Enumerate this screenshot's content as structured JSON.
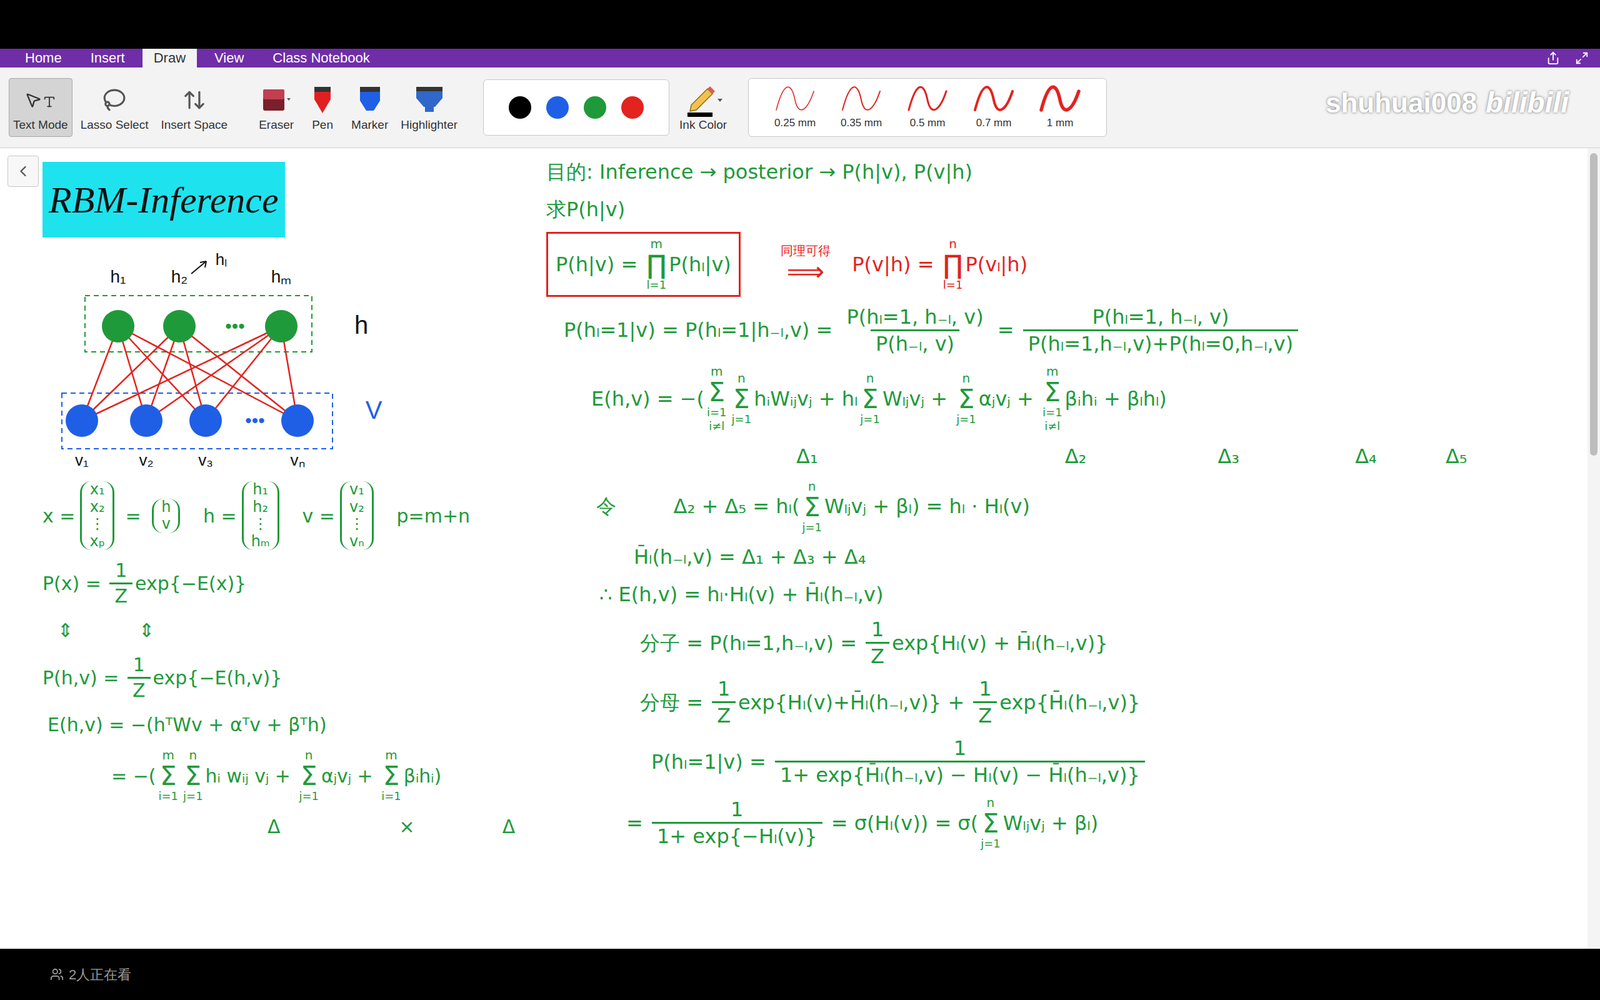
{
  "window": {
    "tabs": [
      {
        "label": "Home",
        "selected": false
      },
      {
        "label": "Insert",
        "selected": false
      },
      {
        "label": "Draw",
        "selected": true
      },
      {
        "label": "View",
        "selected": false
      },
      {
        "label": "Class Notebook",
        "selected": false
      }
    ]
  },
  "ribbon": {
    "tools": [
      {
        "label": "Text Mode",
        "selected": true,
        "kind": "text-mode"
      },
      {
        "label": "Lasso Select",
        "selected": false,
        "kind": "lasso"
      },
      {
        "label": "Insert Space",
        "selected": false,
        "kind": "space"
      },
      {
        "label": "Eraser",
        "selected": false,
        "kind": "eraser"
      },
      {
        "label": "Pen",
        "selected": false,
        "kind": "pen"
      },
      {
        "label": "Marker",
        "selected": false,
        "kind": "marker"
      },
      {
        "label": "Highlighter",
        "selected": false,
        "kind": "highlighter"
      }
    ],
    "swatches": [
      {
        "color": "#000000"
      },
      {
        "color": "#1f5fe6"
      },
      {
        "color": "#1f9a3a"
      },
      {
        "color": "#e3231f"
      }
    ],
    "ink_color": {
      "label": "Ink Color"
    },
    "thickness": [
      {
        "label": "0.25 mm"
      },
      {
        "label": "0.35 mm"
      },
      {
        "label": "0.5 mm"
      },
      {
        "label": "0.7 mm"
      },
      {
        "label": "1 mm"
      }
    ]
  },
  "watermark": {
    "user": "shuhuai008",
    "brand": "bilibili"
  },
  "page": {
    "title": "RBM-Inference",
    "diagram": {
      "hidden": [
        "h₁",
        "h₂",
        "hₘ"
      ],
      "visible": [
        "v₁",
        "v₂",
        "v₃",
        "vₙ"
      ],
      "ellipsis": "•••",
      "pointer_label": "hₗ",
      "hidden_layer": "h",
      "visible_layer": "V"
    },
    "left_notes": [
      {
        "groups": [
          {
            "color": "#1f9a3a",
            "boxed": false,
            "parts": [
              {
                "kind": "text",
                "text": "x ="
              },
              {
                "kind": "vec",
                "items": [
                  "x₁",
                  "x₂",
                  "⋮",
                  "xₚ"
                ]
              },
              {
                "kind": "text",
                "text": " = "
              },
              {
                "kind": "vec",
                "items": [
                  "h",
                  "v"
                ]
              },
              {
                "kind": "text",
                "text": "   h ="
              },
              {
                "kind": "vec",
                "items": [
                  "h₁",
                  "h₂",
                  "⋮",
                  "hₘ"
                ]
              },
              {
                "kind": "text",
                "text": "   v ="
              },
              {
                "kind": "vec",
                "items": [
                  "v₁",
                  "v₂",
                  "⋮",
                  "vₙ"
                ]
              },
              {
                "kind": "text",
                "text": "   p=m+n"
              }
            ]
          }
        ]
      },
      {
        "groups": [
          {
            "color": "#1f9a3a",
            "boxed": false,
            "parts": [
              {
                "kind": "text",
                "text": "P(x) = "
              },
              {
                "kind": "frac",
                "num": "1",
                "den": "Z"
              },
              {
                "kind": "text",
                "text": "exp{−E(x)}"
              }
            ]
          }
        ]
      },
      {
        "groups": [
          {
            "color": "#1f9a3a",
            "boxed": false,
            "parts": [
              {
                "kind": "text",
                "text": "⇕           ⇕"
              }
            ]
          }
        ]
      },
      {
        "groups": [
          {
            "color": "#1f9a3a",
            "boxed": false,
            "parts": [
              {
                "kind": "text",
                "text": "P(h,v) = "
              },
              {
                "kind": "frac",
                "num": "1",
                "den": "Z"
              },
              {
                "kind": "text",
                "text": "exp{−E(h,v)}"
              }
            ]
          }
        ]
      },
      {
        "groups": [
          {
            "color": "#1f9a3a",
            "boxed": false,
            "parts": [
              {
                "kind": "text",
                "text": "E(h,v) = −(hᵀWv + αᵀv + βᵀh)"
              }
            ]
          }
        ]
      },
      {
        "groups": [
          {
            "color": "#1f9a3a",
            "boxed": false,
            "parts": [
              {
                "kind": "text",
                "text": "= −("
              },
              {
                "kind": "sum",
                "sym": "Σ",
                "top": "m",
                "bottom": [
                  "i=1"
                ]
              },
              {
                "kind": "sum",
                "sym": "Σ",
                "top": "n",
                "bottom": [
                  "j=1"
                ]
              },
              {
                "kind": "text",
                "text": "hᵢ wᵢⱼ vⱼ + "
              },
              {
                "kind": "sum",
                "sym": "Σ",
                "top": "n",
                "bottom": [
                  "j=1"
                ]
              },
              {
                "kind": "text",
                "text": "αⱼvⱼ + "
              },
              {
                "kind": "sum",
                "sym": "Σ",
                "top": "m",
                "bottom": [
                  "i=1"
                ]
              },
              {
                "kind": "text",
                "text": "βᵢhᵢ)"
              }
            ]
          }
        ]
      },
      {
        "groups": [
          {
            "color": "#1f9a3a",
            "boxed": false,
            "parts": [
              {
                "kind": "labels",
                "items": [
                  "Δ",
                  "×",
                  "Δ"
                ]
              }
            ]
          }
        ]
      }
    ],
    "right_notes": [
      {
        "groups": [
          {
            "color": "#1f9a3a",
            "boxed": false,
            "parts": [
              {
                "kind": "text",
                "text": "目的: Inference → posterior → P(h|v), P(v|h)"
              }
            ]
          }
        ]
      },
      {
        "groups": [
          {
            "color": "#1f9a3a",
            "boxed": false,
            "parts": [
              {
                "kind": "text",
                "text": "求P(h|v)"
              }
            ]
          }
        ]
      },
      {
        "groups": [
          {
            "color": "#1f9a3a",
            "boxed": true,
            "box_color": "#e3231f",
            "parts": [
              {
                "kind": "text",
                "text": "P(h|v) = "
              },
              {
                "kind": "sum",
                "sym": "∏",
                "top": "m",
                "bottom": [
                  "l=1"
                ]
              },
              {
                "kind": "text",
                "text": "P(hₗ|v)"
              }
            ]
          },
          {
            "color": "#e3231f",
            "boxed": false,
            "parts": [
              {
                "kind": "sum",
                "sym": "⟹",
                "top": "同理可得",
                "bottom": []
              },
              {
                "kind": "text",
                "text": "   P(v|h) = "
              },
              {
                "kind": "sum",
                "sym": "∏",
                "top": "n",
                "bottom": [
                  "l=1"
                ]
              },
              {
                "kind": "text",
                "text": "P(vₗ|h)"
              }
            ]
          }
        ]
      },
      {
        "groups": [
          {
            "color": "#1f9a3a",
            "boxed": false,
            "parts": [
              {
                "kind": "text",
                "text": "P(hₗ=1|v) = P(hₗ=1|h₋ₗ,v) = "
              },
              {
                "kind": "frac",
                "num": "P(hₗ=1, h₋ₗ, v)",
                "den": "P(h₋ₗ, v)"
              },
              {
                "kind": "text",
                "text": " = "
              },
              {
                "kind": "frac",
                "num": "P(hₗ=1, h₋ₗ, v)",
                "den": "P(hₗ=1,h₋ₗ,v)+P(hₗ=0,h₋ₗ,v)"
              }
            ]
          }
        ]
      },
      {
        "groups": [
          {
            "color": "#1f9a3a",
            "boxed": false,
            "parts": [
              {
                "kind": "text",
                "text": "E(h,v) = −("
              },
              {
                "kind": "sum",
                "sym": "Σ",
                "top": "m",
                "bottom": [
                  "i=1",
                  "i≠l"
                ]
              },
              {
                "kind": "sum",
                "sym": "Σ",
                "top": "n",
                "bottom": [
                  "j=1"
                ]
              },
              {
                "kind": "text",
                "text": "hᵢWᵢⱼvⱼ + hₗ"
              },
              {
                "kind": "sum",
                "sym": "Σ",
                "top": "n",
                "bottom": [
                  "j=1"
                ]
              },
              {
                "kind": "text",
                "text": "Wₗⱼvⱼ + "
              },
              {
                "kind": "sum",
                "sym": "Σ",
                "top": "n",
                "bottom": [
                  "j=1"
                ]
              },
              {
                "kind": "text",
                "text": "αⱼvⱼ + "
              },
              {
                "kind": "sum",
                "sym": "Σ",
                "top": "m",
                "bottom": [
                  "i=1",
                  "i≠l"
                ]
              },
              {
                "kind": "text",
                "text": "βᵢhᵢ + βₗhₗ)"
              }
            ]
          }
        ]
      },
      {
        "groups": [
          {
            "color": "#1f9a3a",
            "boxed": false,
            "parts": [
              {
                "kind": "labels",
                "items": [
                  "Δ₁",
                  "Δ₂",
                  "Δ₃",
                  "Δ₄",
                  "Δ₅"
                ]
              }
            ]
          }
        ]
      },
      {
        "groups": [
          {
            "color": "#1f9a3a",
            "boxed": false,
            "parts": [
              {
                "kind": "text",
                "text": "令         Δ₂ + Δ₅ = hₗ("
              },
              {
                "kind": "sum",
                "sym": "Σ",
                "top": "n",
                "bottom": [
                  "j=1"
                ]
              },
              {
                "kind": "text",
                "text": "Wₗⱼvⱼ + βₗ) = hₗ · Hₗ(v)"
              }
            ]
          }
        ]
      },
      {
        "groups": [
          {
            "color": "#1f9a3a",
            "boxed": false,
            "parts": [
              {
                "kind": "text",
                "text": "H̄ₗ(h₋ₗ,v) = Δ₁ + Δ₃ + Δ₄"
              }
            ]
          }
        ]
      },
      {
        "groups": [
          {
            "color": "#1f9a3a",
            "boxed": false,
            "parts": [
              {
                "kind": "text",
                "text": "∴ E(h,v) = hₗ·Hₗ(v) + H̄ₗ(h₋ₗ,v)"
              }
            ]
          }
        ]
      },
      {
        "groups": [
          {
            "color": "#1f9a3a",
            "boxed": false,
            "parts": [
              {
                "kind": "text",
                "text": "分子 = P(hₗ=1,h₋ₗ,v) = "
              },
              {
                "kind": "frac",
                "num": "1",
                "den": "Z"
              },
              {
                "kind": "text",
                "text": "exp{Hₗ(v) + H̄ₗ(h₋ₗ,v)}"
              }
            ]
          }
        ]
      },
      {
        "groups": [
          {
            "color": "#1f9a3a",
            "boxed": false,
            "parts": [
              {
                "kind": "text",
                "text": "分母 = "
              },
              {
                "kind": "frac",
                "num": "1",
                "den": "Z"
              },
              {
                "kind": "text",
                "text": "exp{Hₗ(v)+H̄ₗ(h₋ₗ,v)} + "
              },
              {
                "kind": "frac",
                "num": "1",
                "den": "Z"
              },
              {
                "kind": "text",
                "text": "exp{H̄ₗ(h₋ₗ,v)}"
              }
            ]
          }
        ]
      },
      {
        "groups": [
          {
            "color": "#1f9a3a",
            "boxed": false,
            "parts": [
              {
                "kind": "text",
                "text": "P(hₗ=1|v) = "
              },
              {
                "kind": "frac",
                "num": "1",
                "den": "1+ exp{H̄ₗ(h₋ₗ,v) − Hₗ(v) − H̄ₗ(h₋ₗ,v)}"
              }
            ]
          }
        ]
      },
      {
        "groups": [
          {
            "color": "#1f9a3a",
            "boxed": false,
            "parts": [
              {
                "kind": "text",
                "text": "= "
              },
              {
                "kind": "frac",
                "num": "1",
                "den": "1+ exp{−Hₗ(v)}"
              },
              {
                "kind": "text",
                "text": " = σ(Hₗ(v)) = σ("
              },
              {
                "kind": "sum",
                "sym": "Σ",
                "top": "n",
                "bottom": [
                  "j=1"
                ]
              },
              {
                "kind": "text",
                "text": "Wₗⱼvⱼ + βₗ)"
              }
            ]
          }
        ]
      }
    ]
  },
  "scrollbar": {
    "level": 0.38
  },
  "footer": {
    "viewers": "2人正在看"
  }
}
